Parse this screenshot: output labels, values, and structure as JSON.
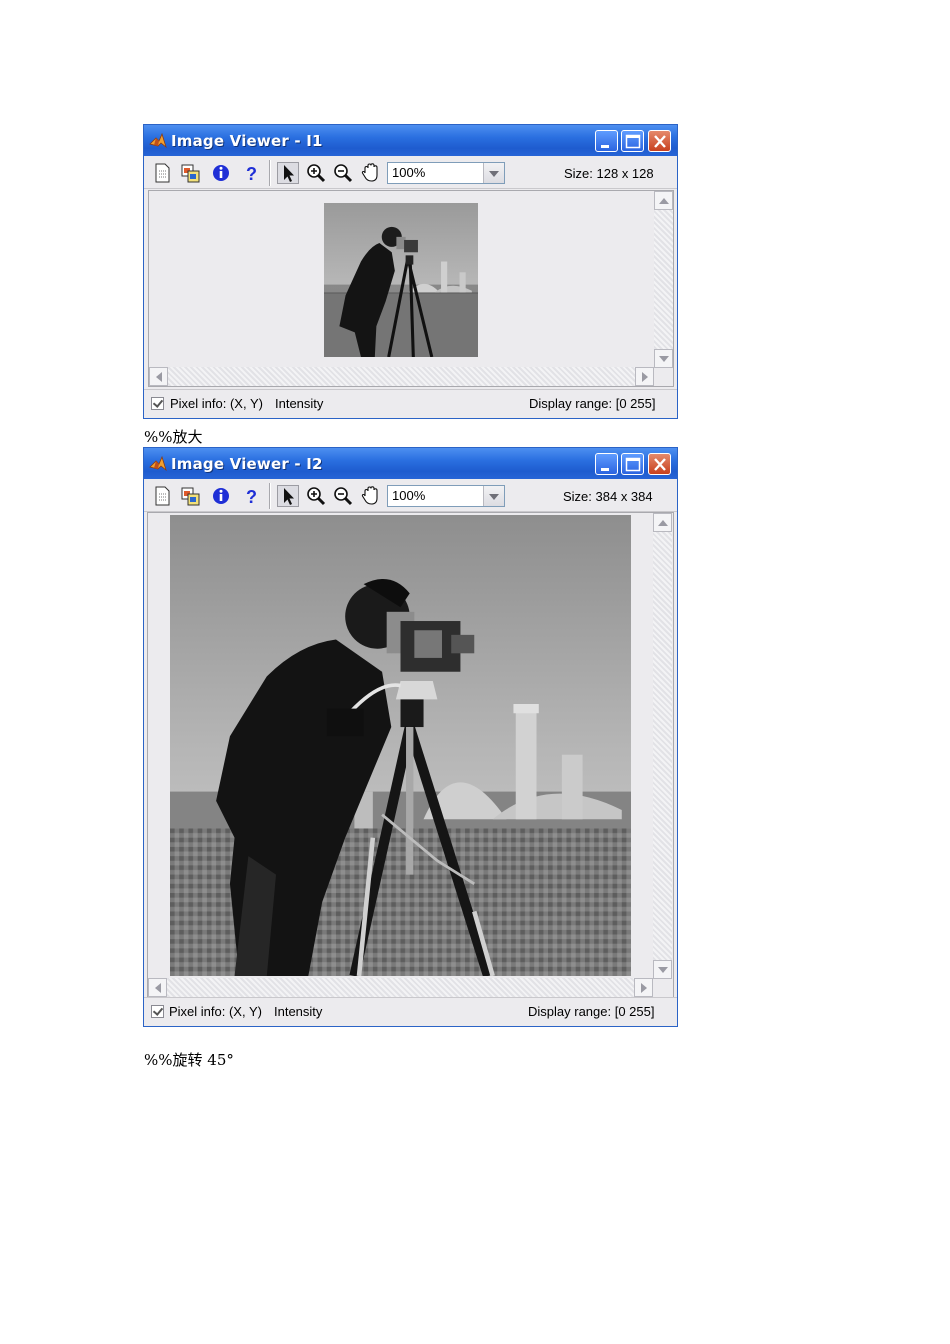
{
  "windows": [
    {
      "title": "Image Viewer - I1",
      "zoom": "100%",
      "size_label": "Size: 128 x 128",
      "pixel_info_label": "Pixel info: (X, Y)",
      "intensity_label": "Intensity",
      "display_range": "Display range: [0  255]"
    },
    {
      "title": "Image Viewer - I2",
      "zoom": "100%",
      "size_label": "Size: 384 x 384",
      "pixel_info_label": "Pixel info: (X, Y)",
      "intensity_label": "Intensity",
      "display_range": "Display range: [0  255]"
    }
  ],
  "captions": {
    "zoom_in": "%%放大",
    "rotate": "%%旋转 45°"
  },
  "colors": {
    "titlebar": "#2a6fe0",
    "window_bg": "#ecebee",
    "info_icon": "#1f2fd6"
  }
}
